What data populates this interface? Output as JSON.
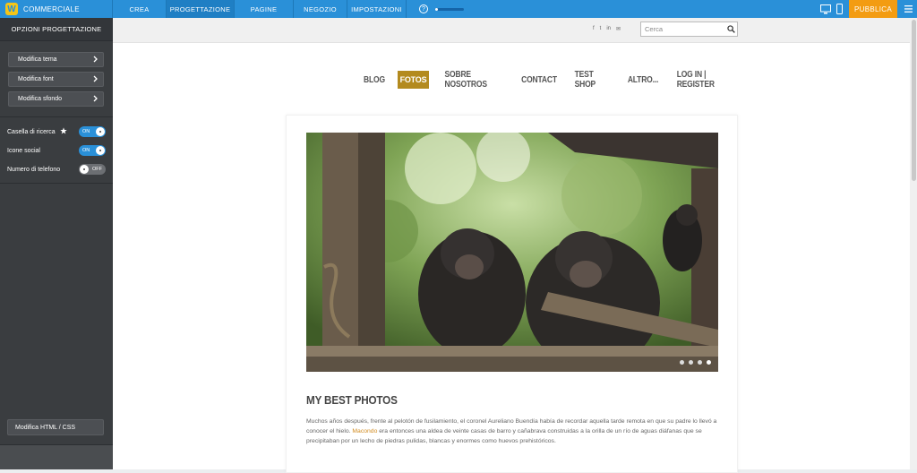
{
  "topbar": {
    "brand": "COMMERCIALE",
    "tabs": [
      {
        "label": "CREA",
        "active": false
      },
      {
        "label": "PROGETTAZIONE",
        "active": true
      },
      {
        "label": "PAGINE",
        "active": false
      },
      {
        "label": "NEGOZIO",
        "active": false
      },
      {
        "label": "IMPOSTAZIONI",
        "active": false
      }
    ],
    "help": "?",
    "progress_fraction": 0.1,
    "publish": "PUBBLICA"
  },
  "sidebar": {
    "header": "OPZIONI PROGETTAZIONE",
    "buttons": [
      {
        "label": "Modifica tema"
      },
      {
        "label": "Modifica font"
      },
      {
        "label": "Modifica sfondo"
      }
    ],
    "toggles": [
      {
        "label": "Casella di ricerca",
        "state": "ON",
        "on": true,
        "starred": true
      },
      {
        "label": "Icone social",
        "state": "ON",
        "on": true,
        "starred": false
      },
      {
        "label": "Numero di telefono",
        "state": "OFF",
        "on": false,
        "starred": false
      }
    ],
    "html_button": "Modifica HTML / CSS"
  },
  "site": {
    "search_placeholder": "Cerca",
    "socials": [
      "f",
      "t",
      "in",
      "✉"
    ],
    "nav": [
      {
        "label": "BLOG",
        "active": false
      },
      {
        "label": "FOTOS",
        "active": true
      },
      {
        "label": "SOBRE NOSOTROS",
        "active": false
      },
      {
        "label": "CONTACT",
        "active": false
      },
      {
        "label": "TEST SHOP",
        "active": false
      },
      {
        "label": "ALTRO...",
        "active": false
      },
      {
        "label": "LOG IN | REGISTER",
        "active": false
      }
    ],
    "slides": 4,
    "active_slide": 4,
    "post": {
      "title": "MY BEST PHOTOS",
      "body_before": "Muchos años después, frente al pelotón de fusilamiento, el coronel Aureliano Buendía había de recordar aquella tarde remota en que su padre lo llevó a conocer el hielo. ",
      "link": "Macondo",
      "body_after": " era entonces una aldea de veinte casas de barro y cañabrava construidas a la orilla de un río de aguas diáfanas que se precipitaban por un lecho de piedras pulidas, blancas y enormes como huevos prehistóricos."
    }
  },
  "colors": {
    "topbar": "#2a90d8",
    "publish": "#f39c12",
    "sidebar": "#3a3d40",
    "nav_active": "#b38a1e",
    "link": "#d18b1f"
  }
}
